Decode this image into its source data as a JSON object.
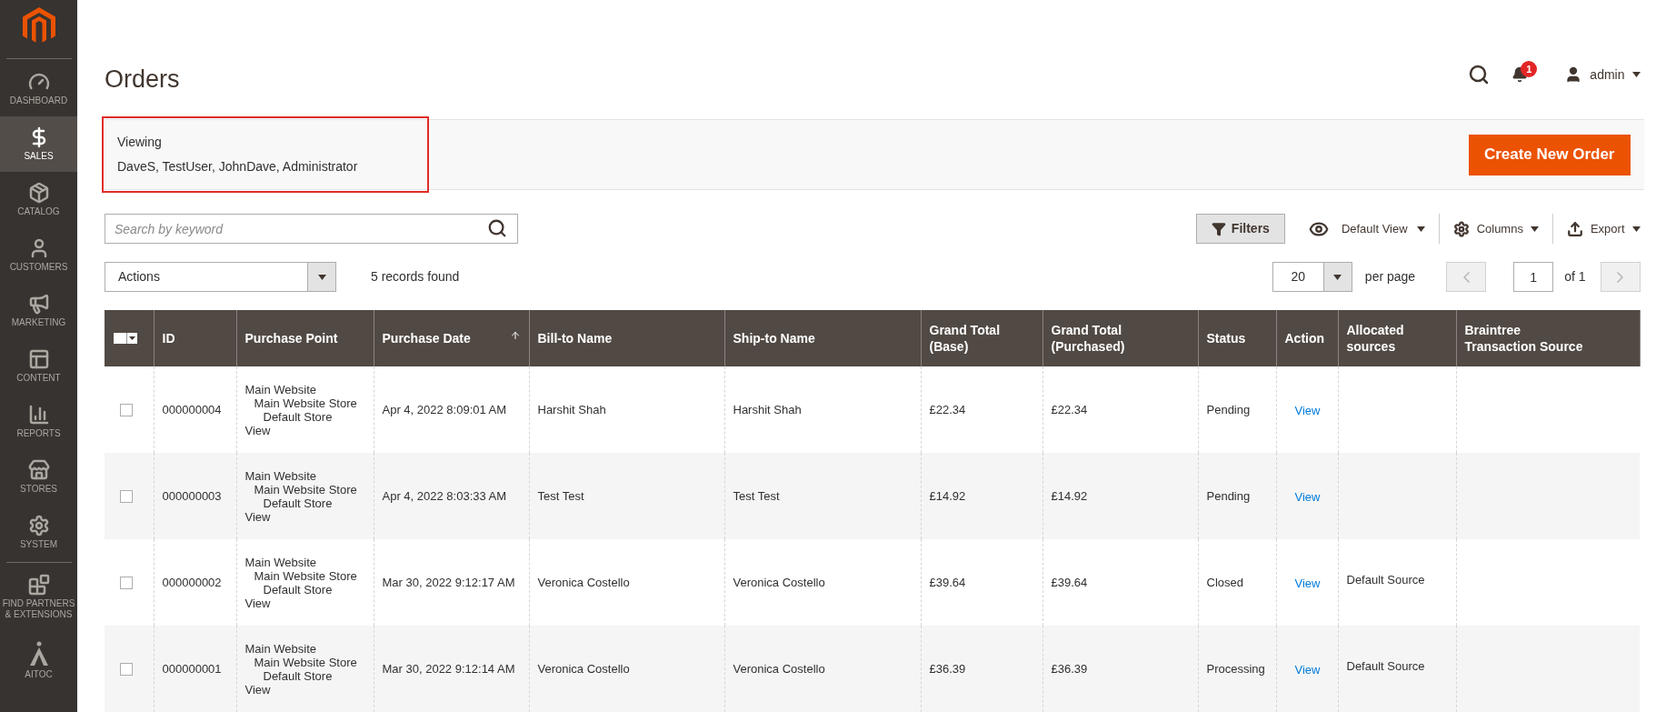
{
  "sidebar": {
    "items": [
      {
        "kind": "dashboard",
        "label": "DASHBOARD",
        "selected": false
      },
      {
        "kind": "sales",
        "label": "SALES",
        "selected": true
      },
      {
        "kind": "catalog",
        "label": "CATALOG",
        "selected": false
      },
      {
        "kind": "customers",
        "label": "CUSTOMERS",
        "selected": false
      },
      {
        "kind": "marketing",
        "label": "MARKETING",
        "selected": false
      },
      {
        "kind": "content",
        "label": "CONTENT",
        "selected": false
      },
      {
        "kind": "reports",
        "label": "REPORTS",
        "selected": false
      },
      {
        "kind": "stores",
        "label": "STORES",
        "selected": false
      },
      {
        "kind": "system",
        "label": "SYSTEM",
        "selected": false
      },
      {
        "kind": "partners",
        "label": "FIND PARTNERS & EXTENSIONS",
        "selected": false
      },
      {
        "kind": "aitoc",
        "label": "AITOC",
        "selected": false
      }
    ]
  },
  "page_title": "Orders",
  "header": {
    "notifications": "1",
    "user": "admin"
  },
  "viewing": {
    "label": "Viewing",
    "value": "DaveS, TestUser, JohnDave, Administrator"
  },
  "create_button": "Create New Order",
  "search": {
    "placeholder": "Search by keyword"
  },
  "toolbar": {
    "filters": "Filters",
    "view": "Default View",
    "columns": "Columns",
    "export": "Export"
  },
  "actions": "Actions",
  "records": "5 records found",
  "pager": {
    "per_page_value": "20",
    "per_page": "per page",
    "page": "1",
    "of": "of 1"
  },
  "table": {
    "columns": [
      "ID",
      "Purchase Point",
      "Purchase Date",
      "Bill-to Name",
      "Ship-to Name",
      "Grand Total (Base)",
      "Grand Total (Purchased)",
      "Status",
      "Action",
      "Allocated sources",
      "Braintree Transaction Source"
    ],
    "rows": [
      {
        "checked": false,
        "id": "000000004",
        "purchase_point": [
          "Main Website",
          "Main Website Store",
          "Default Store",
          "View"
        ],
        "date": "Apr 4, 2022 8:09:01 AM",
        "bill_to": "Harshit Shah",
        "ship_to": "Harshit Shah",
        "total_base": "£22.34",
        "total_purchased": "£22.34",
        "status": "Pending",
        "action": "View"
      },
      {
        "checked": false,
        "id": "000000003",
        "purchase_point": [
          "Main Website",
          "Main Website Store",
          "Default Store",
          "View"
        ],
        "date": "Apr 4, 2022 8:03:33 AM",
        "bill_to": "Test Test",
        "ship_to": "Test Test",
        "total_base": "£14.92",
        "total_purchased": "£14.92",
        "status": "Pending",
        "action": "View"
      },
      {
        "checked": false,
        "id": "000000002",
        "purchase_point": [
          "Main Website",
          "Main Website Store",
          "Default Store",
          "View"
        ],
        "date": "Mar 30, 2022 9:12:17 AM",
        "bill_to": "Veronica Costello",
        "ship_to": "Veronica Costello",
        "total_base": "£39.64",
        "total_purchased": "£39.64",
        "status": "Closed",
        "action": "View",
        "allocated": "Default Source"
      },
      {
        "checked": false,
        "id": "000000001",
        "purchase_point": [
          "Main Website",
          "Main Website Store",
          "Default Store",
          "View"
        ],
        "date": "Mar 30, 2022 9:12:14 AM",
        "bill_to": "Veronica Costello",
        "ship_to": "Veronica Costello",
        "total_base": "£36.39",
        "total_purchased": "£36.39",
        "status": "Processing",
        "action": "View",
        "allocated": "Default Source"
      }
    ]
  }
}
